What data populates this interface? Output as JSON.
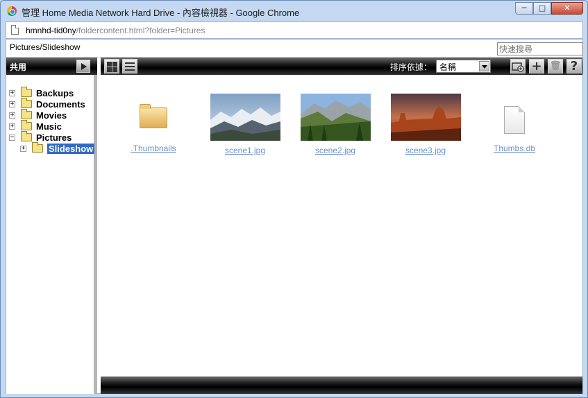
{
  "window": {
    "title": "管理 Home Media Network Hard Drive - 內容檢視器 - Google Chrome",
    "minimize": "─",
    "maximize": "□",
    "close": "✕"
  },
  "address": {
    "host": "hmnhd-tid0ny",
    "path": "/foldercontent.html?folder=Pictures"
  },
  "pathbar": {
    "current_path": "Pictures/Slideshow",
    "search_placeholder": "快速搜尋"
  },
  "left": {
    "share_label": "共用",
    "tree": [
      {
        "label": "Backups",
        "expander": "+"
      },
      {
        "label": "Documents",
        "expander": "+"
      },
      {
        "label": "Movies",
        "expander": "+"
      },
      {
        "label": "Music",
        "expander": "+"
      },
      {
        "label": "Pictures",
        "expander": "−"
      },
      {
        "label": "Slideshow",
        "expander": "+",
        "selected": true
      }
    ]
  },
  "toolbar": {
    "sort_label": "排序依據：",
    "sort_value": "名稱",
    "add_label": "+",
    "delete_label": "🗑",
    "help_label": "?"
  },
  "files": [
    {
      "name": ".Thumbnails",
      "type": "folder-icon"
    },
    {
      "name": "scene1.jpg",
      "type": "image-thumbnail"
    },
    {
      "name": "scene2.jpg",
      "type": "image-thumbnail"
    },
    {
      "name": "scene3.jpg",
      "type": "image-thumbnail"
    },
    {
      "name": "Thumbs.db",
      "type": "document-icon"
    }
  ]
}
